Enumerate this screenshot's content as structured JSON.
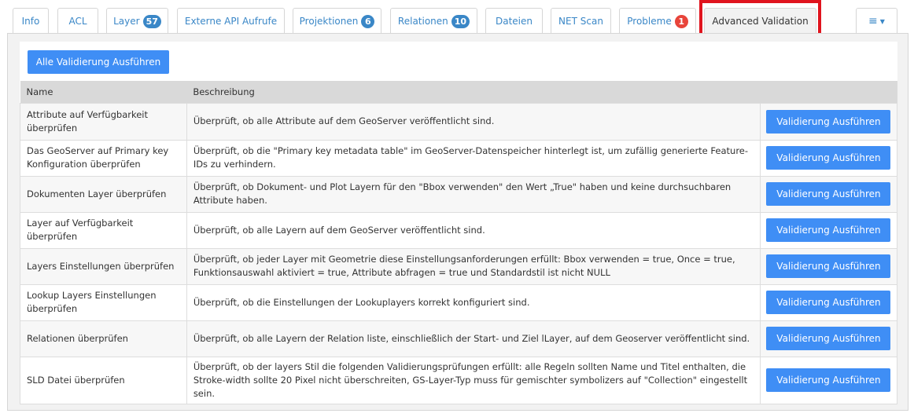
{
  "tabs": [
    {
      "label": "Info",
      "badge": null
    },
    {
      "label": "ACL",
      "badge": null
    },
    {
      "label": "Layer",
      "badge": "57"
    },
    {
      "label": "Externe API Aufrufe",
      "badge": null
    },
    {
      "label": "Projektionen",
      "badge": "6"
    },
    {
      "label": "Relationen",
      "badge": "10"
    },
    {
      "label": "Dateien",
      "badge": null
    },
    {
      "label": "NET Scan",
      "badge": null
    },
    {
      "label": "Probleme",
      "badge": "1"
    },
    {
      "label": "Advanced Validation",
      "badge": null
    }
  ],
  "active_tab": "Advanced Validation",
  "menu_icon": "list-icon",
  "colors": {
    "accent": "#3f8ef5",
    "link": "#3a87c7",
    "alert_badge": "#e8443a",
    "highlight": "#e0141e"
  },
  "run_all_label": "Alle Validierung Ausführen",
  "table": {
    "headers": [
      "Name",
      "Beschreibung",
      ""
    ],
    "rows": [
      {
        "name": "Attribute auf Verfügbarkeit überprüfen",
        "description": "Überprüft, ob alle Attribute auf dem GeoServer veröffentlicht sind.",
        "action": "Validierung Ausführen"
      },
      {
        "name": "Das GeoServer auf Primary key Konfiguration überprüfen",
        "description": "Überprüft, ob die \"Primary key metadata table\" im GeoServer-Datenspeicher hinterlegt ist, um zufällig generierte Feature-IDs zu verhindern.",
        "action": "Validierung Ausführen"
      },
      {
        "name": "Dokumenten Layer überprüfen",
        "description": "Überprüft, ob Dokument- und Plot Layern für den \"Bbox verwenden\" den Wert „True\" haben und keine durchsuchbaren Attribute haben.",
        "action": "Validierung Ausführen"
      },
      {
        "name": "Layer auf Verfügbarkeit überprüfen",
        "description": "Überprüft, ob alle Layern auf dem GeoServer veröffentlicht sind.",
        "action": "Validierung Ausführen"
      },
      {
        "name": "Layers Einstellungen überprüfen",
        "description": "Überprüft, ob jeder Layer mit Geometrie diese Einstellungsanforderungen erfüllt: Bbox verwenden = true, Once = true, Funktionsauswahl aktiviert = true, Attribute abfragen = true und Standardstil ist nicht NULL",
        "action": "Validierung Ausführen"
      },
      {
        "name": "Lookup Layers Einstellungen überprüfen",
        "description": "Überprüft, ob die Einstellungen der Lookuplayers korrekt konfiguriert sind.",
        "action": "Validierung Ausführen"
      },
      {
        "name": "Relationen überprüfen",
        "description": "Überprüft, ob alle Layern der Relation liste, einschließlich der Start- und Ziel lLayer, auf dem Geoserver veröffentlicht sind.",
        "action": "Validierung Ausführen"
      },
      {
        "name": "SLD Datei überprüfen",
        "description": "Überprüft, ob der layers Stil die folgenden Validierungsprüfungen erfüllt: alle Regeln sollten Name und Titel enthalten, die Stroke-width sollte 20 Pixel nicht überschreiten, GS-Layer-Typ muss für gemischter symbolizers auf \"Collection\" eingestellt sein.",
        "action": "Validierung Ausführen"
      }
    ]
  }
}
